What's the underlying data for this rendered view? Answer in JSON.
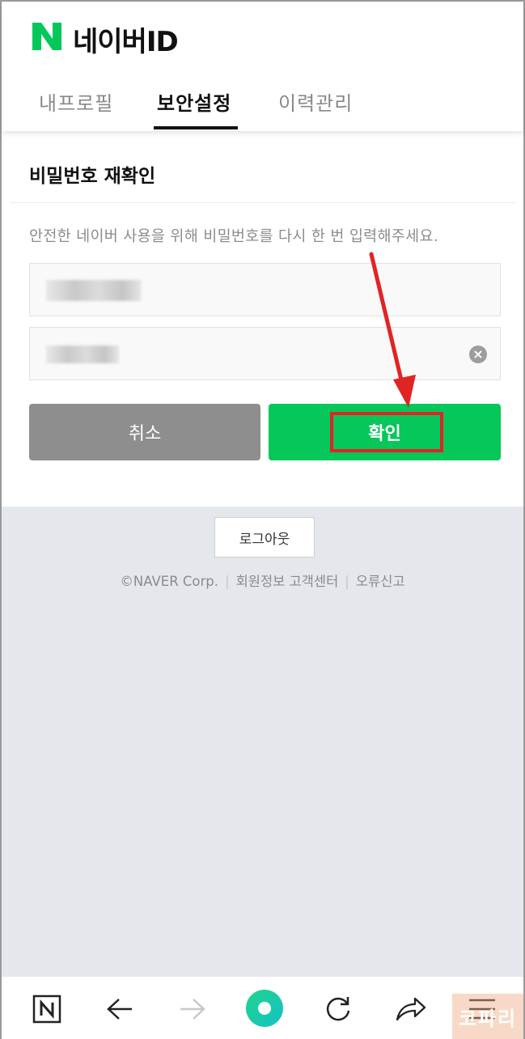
{
  "header": {
    "logo_letter": "N",
    "logo_text": "네이버ID",
    "brand_color": "#03c75a",
    "tabs": [
      {
        "label": "내프로필",
        "active": false
      },
      {
        "label": "보안설정",
        "active": true
      },
      {
        "label": "이력관리",
        "active": false
      }
    ]
  },
  "card": {
    "title": "비밀번호 재확인",
    "description": "안전한 네이버 사용을 위해 비밀번호를 다시 한 번 입력해주세요.",
    "fields": [
      {
        "type": "id",
        "value_obscured": true
      },
      {
        "type": "password",
        "value_obscured": true,
        "clear_icon": "clear-circle-icon"
      }
    ],
    "cancel_label": "취소",
    "confirm_label": "확인"
  },
  "annotation": {
    "color": "#e02424"
  },
  "footer": {
    "logout_label": "로그아웃",
    "copyright": "©NAVER Corp.",
    "links": [
      "회원정보 고객센터",
      "오류신고"
    ]
  },
  "bottom_bar": {
    "icons": [
      "naver-home-icon",
      "back-arrow-icon",
      "forward-arrow-icon",
      "green-dot-icon",
      "refresh-icon",
      "share-icon",
      "menu-icon"
    ]
  },
  "watermark": {
    "text": "코파리"
  }
}
